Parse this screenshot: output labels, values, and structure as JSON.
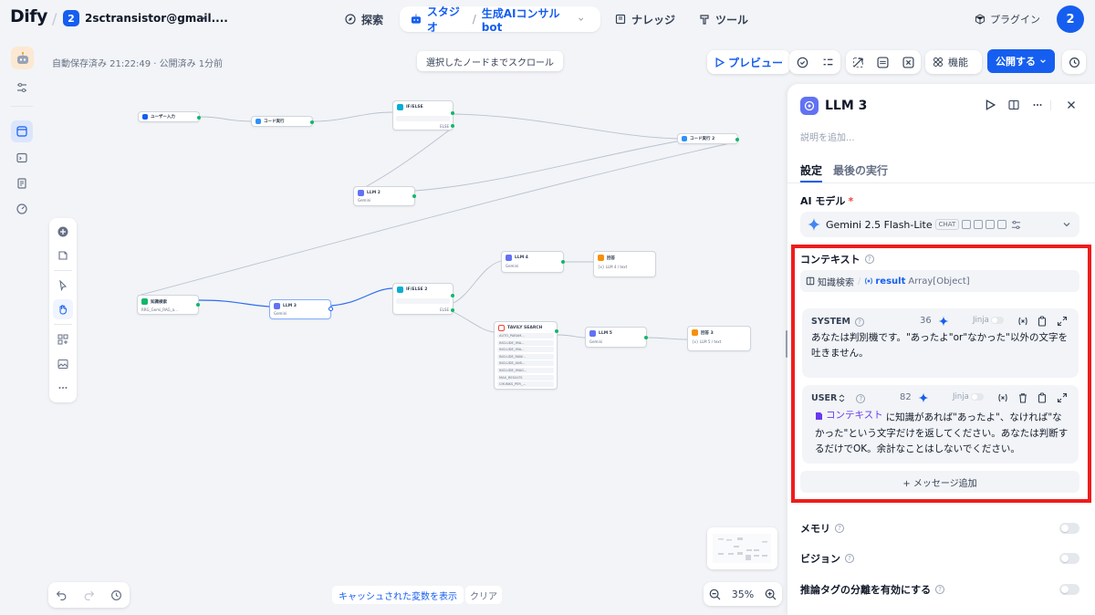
{
  "topbar": {
    "logo_text": "Dify",
    "workspace_badge": "2",
    "workspace_name": "2sctransistor@gmail....",
    "nav": {
      "explore": "探索",
      "studio": "スタジオ",
      "app_name": "生成AIコンサルbot",
      "knowledge": "ナレッジ",
      "tools": "ツール"
    },
    "plugin": "プラグイン",
    "avatar": "2"
  },
  "canvas": {
    "autosave": "自動保存済み 21:22:49 · 公開済み 1分前",
    "scroll_to_selected": "選択したノードまでスクロール",
    "preview": "プレビュー",
    "features": "機能",
    "publish": "公開する",
    "cache_vars": "キャッシュされた変数を表示",
    "clear": "クリア",
    "zoom": "35%",
    "nodes": {
      "start": "ユーザー入力",
      "code1": "コード実行",
      "ifelse1": "IF/ELSE",
      "code2": "コード実行 2",
      "llm2": "LLM 2",
      "llm2_model": "Gemini",
      "knowledge": "知識検索",
      "knowledge_sub": "RRG_Gemi_RAG_a...",
      "llm3": "LLM 3",
      "llm3_model": "Gemini",
      "ifelse2": "IF/ELSE 2",
      "llm4": "LLM 4",
      "llm4_model": "Gemini",
      "answer1": "回答",
      "answer1_sub": "{x} LLM 4 / text",
      "tavily": "TAVILY SEARCH",
      "tavily_params": [
        "AUTO_PARAM...",
        "INCLUDE_IMA...",
        "INCLUDE_IMA...",
        "INCLUDE_RAW...",
        "INCLUDE_ANS...",
        "INCLUDE_IMAG...",
        "MAX_RESULTS",
        "CHUNKS_PER_..."
      ],
      "llm5": "LLM 5",
      "llm5_model": "Gemini",
      "answer3": "回答 3",
      "answer3_sub": "{x} LLM 5 / text",
      "else_label": "ELSE",
      "if_label": "IF"
    }
  },
  "panel": {
    "title": "LLM 3",
    "desc_placeholder": "説明を追加...",
    "tabs": [
      "設定",
      "最後の実行"
    ],
    "ai_model_label": "AI モデル",
    "model_name": "Gemini 2.5 Flash-Lite",
    "model_tag": "CHAT",
    "context_label": "コンテキスト",
    "context_var": {
      "node": "知識検索",
      "var": "result",
      "type": "Array[Object]"
    },
    "system": {
      "role": "SYSTEM",
      "count": "36",
      "jinja": "Jinja",
      "text": "あなたは判別機です。\"あったよ\"or\"なかった\"以外の文字を吐きません。"
    },
    "user": {
      "role": "USER",
      "count": "82",
      "jinja": "Jinja",
      "chip": "コンテキスト",
      "text": "に知識があれば\"あったよ\"、なければ\"なかった\"という文字だけを返してください。あなたは判断するだけでOK。余計なことはしないでください。"
    },
    "add_message": "+ メッセージ追加",
    "memory": "メモリ",
    "vision": "ビジョン",
    "reasoning": "推論タグの分離を有効にする"
  },
  "colors": {
    "accent": "#155eef",
    "highlight": "#ee1c1c"
  }
}
